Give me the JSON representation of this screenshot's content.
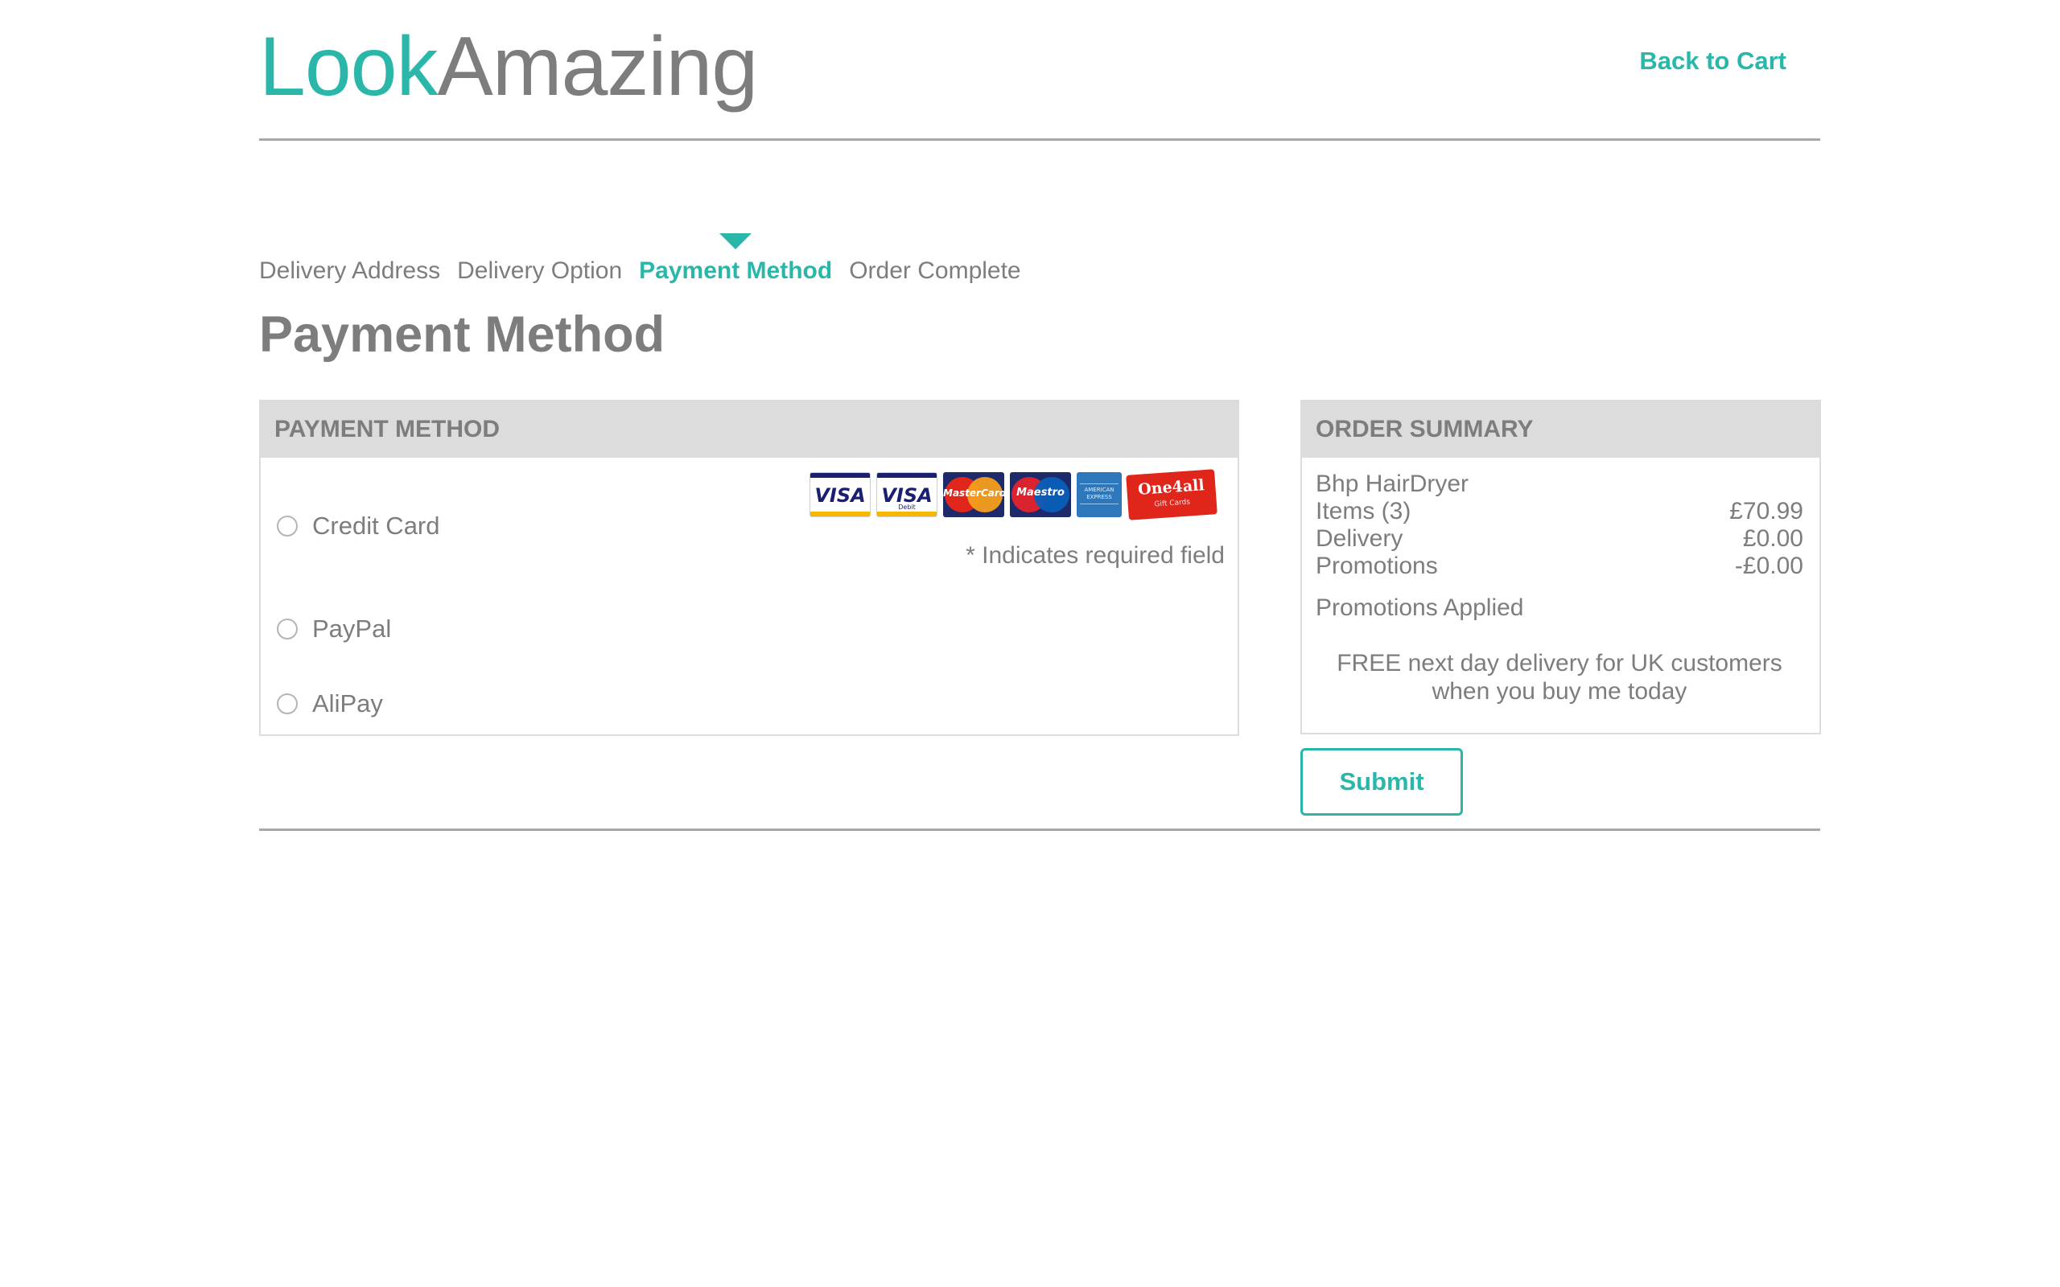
{
  "header": {
    "logo_part1": "Look",
    "logo_part2": "Amazing",
    "back_link": "Back to Cart"
  },
  "steps": [
    {
      "label": "Delivery Address",
      "active": false
    },
    {
      "label": "Delivery Option",
      "active": false
    },
    {
      "label": "Payment Method",
      "active": true
    },
    {
      "label": "Order Complete",
      "active": false
    }
  ],
  "page_title": "Payment Method",
  "payment": {
    "heading": "PAYMENT METHOD",
    "options": [
      {
        "label": "Credit Card",
        "selected": false
      },
      {
        "label": "PayPal",
        "selected": false
      },
      {
        "label": "AliPay",
        "selected": false
      }
    ],
    "required_note": "* Indicates required field",
    "card_logos": {
      "visa": "VISA",
      "visa_debit": "VISA",
      "visa_debit_sub": "Debit",
      "mastercard": "MasterCard",
      "maestro": "Maestro",
      "amex": "AMERICAN EXPRESS",
      "one4all": "One4all",
      "one4all_sub": "Gift Cards"
    }
  },
  "summary": {
    "heading": "ORDER SUMMARY",
    "product": "Bhp HairDryer",
    "rows": [
      {
        "label": "Items (3)",
        "amount": "£70.99"
      },
      {
        "label": "Delivery",
        "amount": "£0.00"
      },
      {
        "label": "Promotions",
        "amount": "-£0.00"
      }
    ],
    "promotions_applied": "Promotions Applied",
    "promo_line1": "FREE next day delivery for UK customers",
    "promo_line2": "when you buy me today"
  },
  "submit_label": "Submit",
  "colors": {
    "accent": "#2ab7aa",
    "text": "#7d7d7d",
    "panel_header": "#dcdcdc"
  }
}
